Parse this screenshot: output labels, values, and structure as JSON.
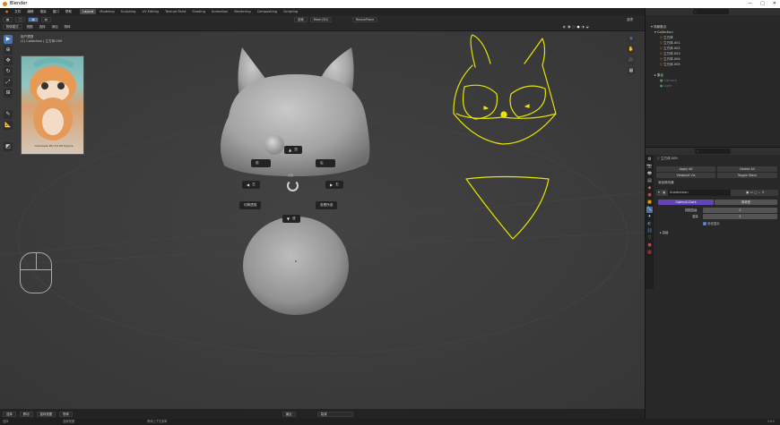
{
  "window": {
    "title": "Blender",
    "controls": [
      "—",
      "□",
      "✕"
    ]
  },
  "topbar": {
    "menus": [
      "文件",
      "编辑",
      "渲染",
      "窗口",
      "帮助"
    ],
    "workspaces": [
      "Layout",
      "Modeling",
      "Sculpting",
      "UV Editing",
      "Texture Paint",
      "Shading",
      "Animation",
      "Rendering",
      "Compositing",
      "Scripting"
    ],
    "active_workspace": "Layout",
    "scene_label": "Scene",
    "view_layer_label": "View Layer",
    "preview_label": "预览"
  },
  "viewport_header": {
    "mode": "物体模式",
    "menus": [
      "视图",
      "选择",
      "添加",
      "物体"
    ],
    "orientation": "全局",
    "snap_label": "ResizePlane",
    "pivot_label": "Mesh(3D)",
    "options_label": "选项"
  },
  "viewport": {
    "view_name": "用户透视",
    "collection_info": "(1) Collection | 立方体.009",
    "pie_menu": {
      "top": "顶",
      "bottom": "底",
      "left": "左",
      "right": "右",
      "front": "前",
      "back": "后",
      "ortho_persp": "切换透视",
      "camera": "摄像机",
      "view_selected": "查看所选",
      "center_label": "视图"
    }
  },
  "reference_image": {
    "caption": "Cute Kawaii Mini Fox Pet Figurine"
  },
  "toolbar": {
    "tools": [
      "select-icon",
      "cursor-icon",
      "move-icon",
      "rotate-icon",
      "scale-icon",
      "transform-icon",
      "annotate-icon",
      "measure-icon",
      "add-cube-icon"
    ]
  },
  "outliner": {
    "title": "场景集合",
    "collection": "Collection",
    "objects": [
      "立方体",
      "立方体.001",
      "立方体.002",
      "立方体.003",
      "立方体.004",
      "立方体.005"
    ],
    "extra_collection": "集合",
    "camera": "Camera",
    "light": "Light"
  },
  "properties": {
    "object_name": "立方体.009",
    "apply_all": "Apply All",
    "delete_all": "Delete All",
    "viewport_vis": "Viewport Vis",
    "toggle_stack": "Toggle Stack",
    "add_modifier": "添加修改器",
    "modifier_name": "Subdivision",
    "catmull_clark": "Catmull-Clark",
    "simple": "简单型",
    "levels_viewport_label": "视图层级",
    "levels_viewport": "2",
    "render_label": "渲染",
    "render_value": "2",
    "optimal_display": "优化显示",
    "advanced": "高级"
  },
  "statusline": {
    "items": [
      "选择",
      "移动",
      "旋转视图",
      "物体"
    ],
    "snap": "最近",
    "proportional": "衰减"
  },
  "statusbar": {
    "left": "选择",
    "center": "旋转视图",
    "mid": "物体上下文菜单",
    "version": "3.6.2"
  },
  "colors": {
    "accent": "#4772b3",
    "modifier_purple": "#6345b5",
    "sketch_yellow": "#e6e600",
    "bg": "#3d3d3d"
  }
}
